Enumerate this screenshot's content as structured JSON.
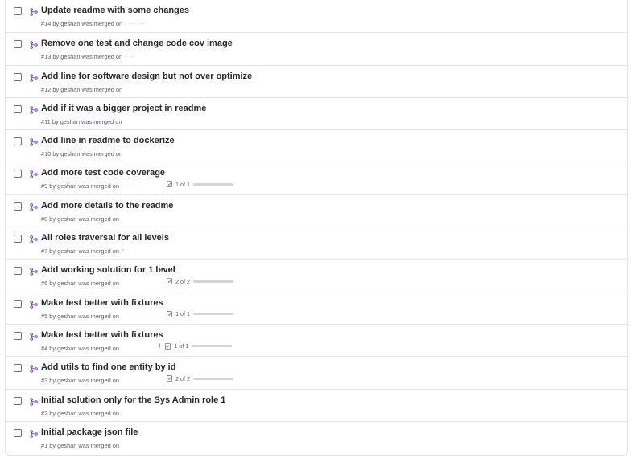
{
  "pull_requests": [
    {
      "title": "Update readme with some changes",
      "meta": "#14 by geshan was merged on",
      "smudge": "- -- ---"
    },
    {
      "title": "Remove one test and change code cov image",
      "meta": "#13 by geshan was merged on",
      "smudge": "- --"
    },
    {
      "title": "Add line for software design but not over optimize",
      "meta": "#12 by geshan was merged on",
      "smudge": ""
    },
    {
      "title": "Add if it was a bigger project in readme",
      "meta": "#11 by geshan was merged on",
      "smudge": ""
    },
    {
      "title": "Add line in readme to dockerize",
      "meta": "#10 by geshan was merged on",
      "smudge": ""
    },
    {
      "title": "Add more test code coverage",
      "meta": "#9 by geshan was merged on",
      "smudge": "- -- -",
      "tasks": "1 of 1",
      "progress": 1.0
    },
    {
      "title": "Add more details to the readme",
      "meta": "#8 by geshan was merged on",
      "smudge": ""
    },
    {
      "title": "All roles traversal for all levels",
      "meta": "#7 by geshan was merged on",
      "smudge": "7"
    },
    {
      "title": "Add working solution for 1 level",
      "meta": "#6 by geshan was merged on",
      "smudge": "",
      "tasks": "2 of 2",
      "progress": 1.0
    },
    {
      "title": "Make test better with fixtures",
      "meta": "#5 by geshan was merged on",
      "smudge": "",
      "tasks": "1 of 1",
      "progress": 1.0
    },
    {
      "title": "Make test better with fixtures",
      "meta": "#4 by geshan was merged on",
      "smudge": "",
      "tasks": "1 of 1",
      "progress": 1.0,
      "bracket": ")"
    },
    {
      "title": "Add utils to find one entity by id",
      "meta": "#3 by geshan was merged on",
      "smudge": "",
      "tasks": "2 of 2",
      "progress": 1.0
    },
    {
      "title": "Initial solution only for the Sys Admin role 1",
      "meta": "#2 by geshan was merged on",
      "smudge": ""
    },
    {
      "title": "Initial package json file",
      "meta": "#1 by geshan was merged on",
      "smudge": ""
    }
  ],
  "colors": {
    "merged_icon": "#6f42c1",
    "border": "#e1e4e8",
    "text": "#24292e",
    "muted": "#586069"
  },
  "icons": {
    "merged": "git-merge-icon",
    "checkbox": "checkbox",
    "tasks": "checklist-icon"
  }
}
